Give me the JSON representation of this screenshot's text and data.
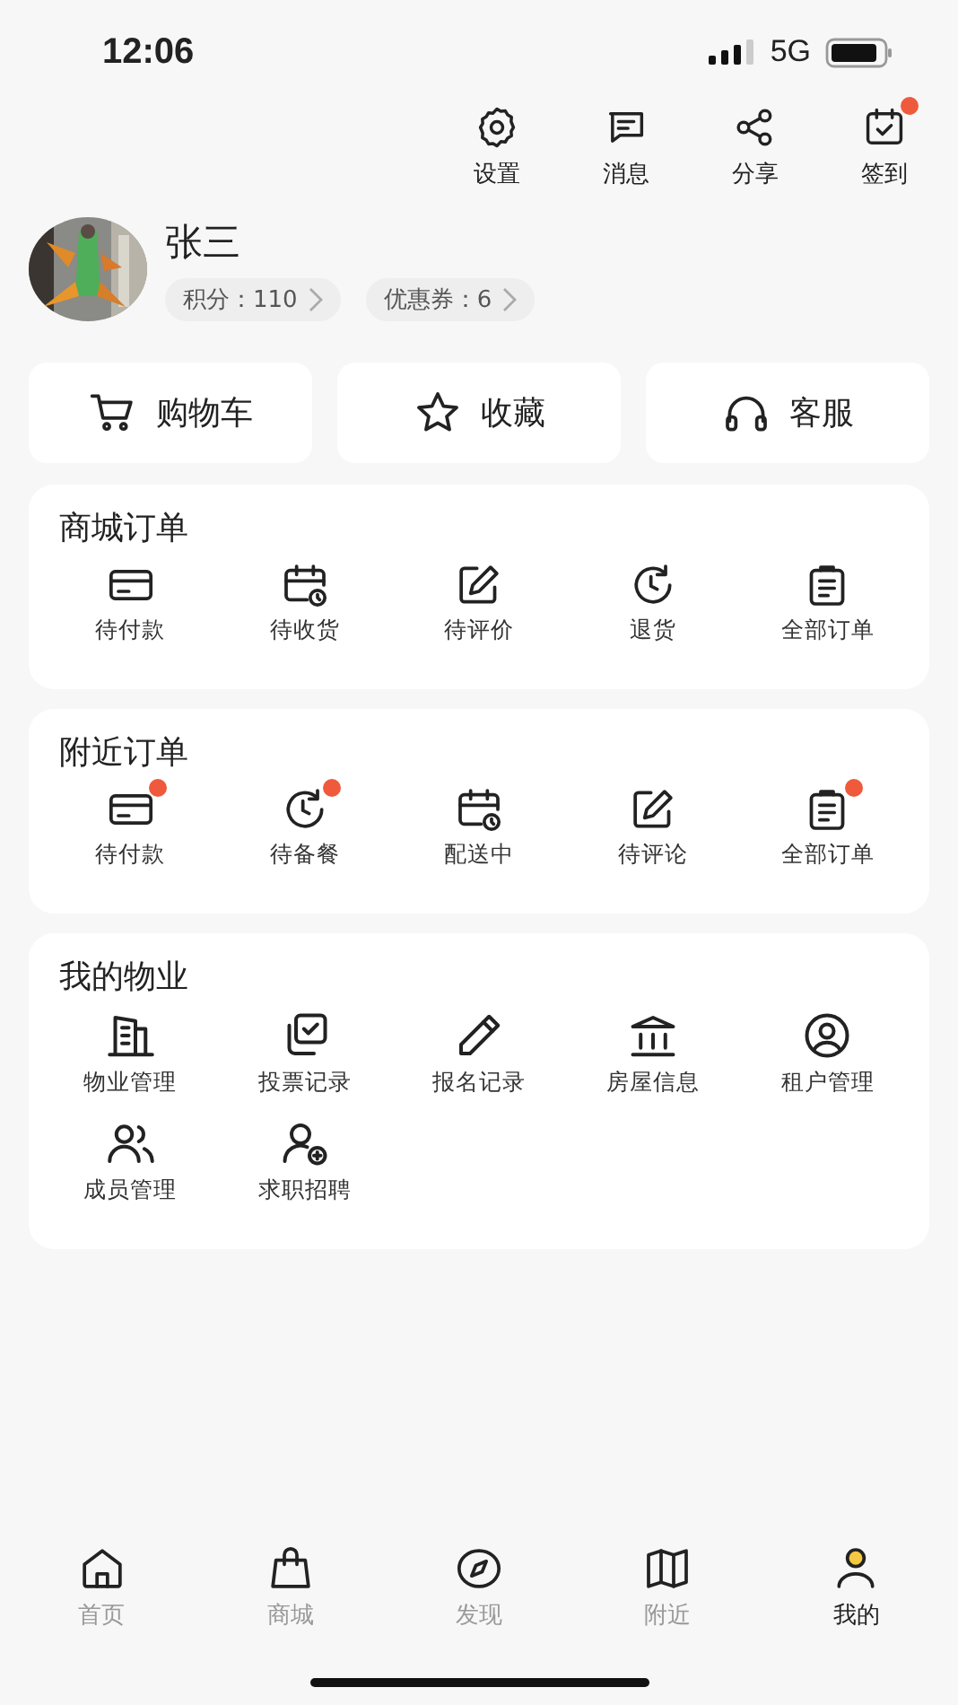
{
  "status_bar": {
    "time": "12:06",
    "network": "5G"
  },
  "top_actions": [
    {
      "label": "设置",
      "dot": false
    },
    {
      "label": "消息",
      "dot": false
    },
    {
      "label": "分享",
      "dot": false
    },
    {
      "label": "签到",
      "dot": true
    }
  ],
  "profile": {
    "name": "张三",
    "avatar": {
      "kind": "picture"
    },
    "chips": [
      "积分：110",
      "优惠券：6"
    ]
  },
  "quick_buttons": [
    "购物车",
    "收藏",
    "客服"
  ],
  "sections": [
    {
      "title": "商城订单",
      "items": [
        {
          "label": "待付款",
          "dot": false
        },
        {
          "label": "待收货",
          "dot": false
        },
        {
          "label": "待评价",
          "dot": false
        },
        {
          "label": "退货",
          "dot": false
        },
        {
          "label": "全部订单",
          "dot": false
        }
      ]
    },
    {
      "title": "附近订单",
      "items": [
        {
          "label": "待付款",
          "dot": true
        },
        {
          "label": "待备餐",
          "dot": true
        },
        {
          "label": "配送中",
          "dot": false
        },
        {
          "label": "待评论",
          "dot": false
        },
        {
          "label": "全部订单",
          "dot": true
        }
      ]
    },
    {
      "title": "我的物业",
      "items": [
        {
          "label": "物业管理",
          "dot": false
        },
        {
          "label": "投票记录",
          "dot": false
        },
        {
          "label": "报名记录",
          "dot": false
        },
        {
          "label": "房屋信息",
          "dot": false
        },
        {
          "label": "租户管理",
          "dot": false
        },
        {
          "label": "成员管理",
          "dot": false
        },
        {
          "label": "求职招聘",
          "dot": false
        }
      ]
    }
  ],
  "tab_bar": [
    {
      "label": "首页",
      "selected": false
    },
    {
      "label": "商城",
      "selected": false
    },
    {
      "label": "发现",
      "selected": false
    },
    {
      "label": "附近",
      "selected": false
    },
    {
      "label": "我的",
      "selected": true
    }
  ]
}
